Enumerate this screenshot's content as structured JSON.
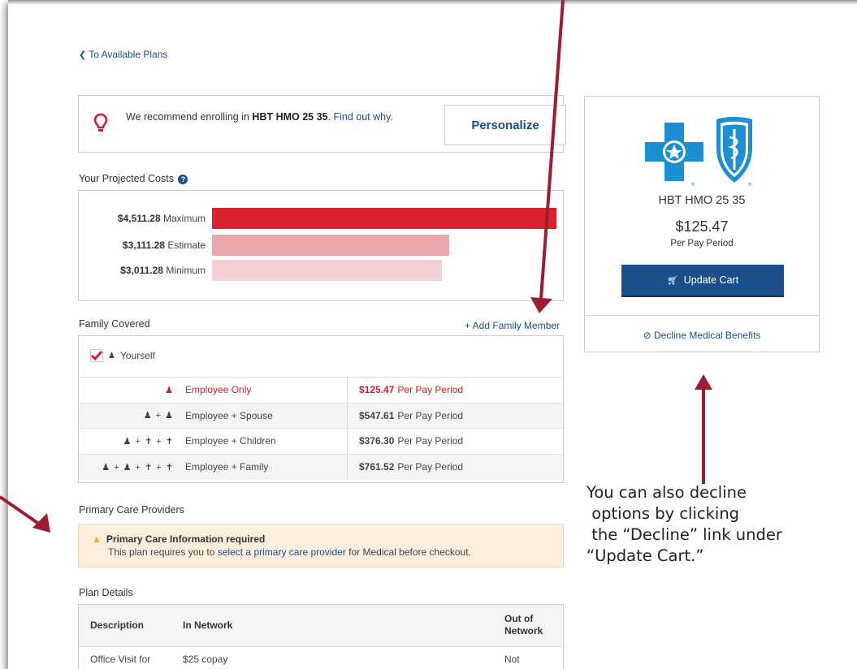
{
  "nav": {
    "back_label": "To Available Plans"
  },
  "recommend": {
    "text_prefix": "We recommend enrolling in ",
    "plan_name": "HBT HMO 25 35",
    "text_suffix": ". ",
    "link_label": "Find out why.",
    "personalize_label": "Personalize"
  },
  "costs": {
    "title": "Your Projected Costs",
    "rows": [
      {
        "amount": "$4,511.28",
        "label": "Maximum",
        "value": 4511.28,
        "color": "#d8232f"
      },
      {
        "amount": "$3,111.28",
        "label": "Estimate",
        "value": 3111.28,
        "color": "#eaa7ac"
      },
      {
        "amount": "$3,011.28",
        "label": "Minimum",
        "value": 3011.28,
        "color": "#f7d0d5"
      }
    ]
  },
  "family": {
    "title": "Family Covered",
    "add_label": "+ Add Family Member",
    "yourself_label": "Yourself",
    "tiers": [
      {
        "icons": "♟",
        "name": "Employee Only",
        "amount": "$125.47",
        "unit": "Per Pay Period",
        "active": true
      },
      {
        "icons": "♟ + ♟",
        "name": "Employee + Spouse",
        "amount": "$547.61",
        "unit": "Per Pay Period",
        "active": false
      },
      {
        "icons": "♟ + ✝ + ✝",
        "name": "Employee + Children",
        "amount": "$376.30",
        "unit": "Per Pay Period",
        "active": false
      },
      {
        "icons": "♟ + ♟ + ✝ + ✝",
        "name": "Employee + Family",
        "amount": "$761.52",
        "unit": "Per Pay Period",
        "active": false
      }
    ]
  },
  "pcp": {
    "title": "Primary Care Providers",
    "warning_title": "Primary Care Information required",
    "warning_prefix": "This plan requires you to ",
    "warning_link": "select a primary care provider",
    "warning_suffix": " for Medical before checkout."
  },
  "plan_details": {
    "title": "Plan Details",
    "headers": {
      "description": "Description",
      "in_network": "In Network",
      "out_network_1": "Out of",
      "out_network_2": "Network"
    },
    "row": {
      "description": "Office Visit for",
      "in_network": "$25 copay",
      "out_network": "Not"
    }
  },
  "card": {
    "plan_name": "HBT HMO 25 35",
    "price": "$125.47",
    "per": "Per Pay Period",
    "cart_label": "Update Cart",
    "decline_label": "Decline Medical Benefits",
    "logo_color": "#1b8fd2"
  },
  "annotation": {
    "lines": [
      "You can also decline",
      " options by clicking",
      " the “Decline” link under",
      "“Update Cart.”"
    ],
    "arrow_color": "#9e1c30"
  }
}
